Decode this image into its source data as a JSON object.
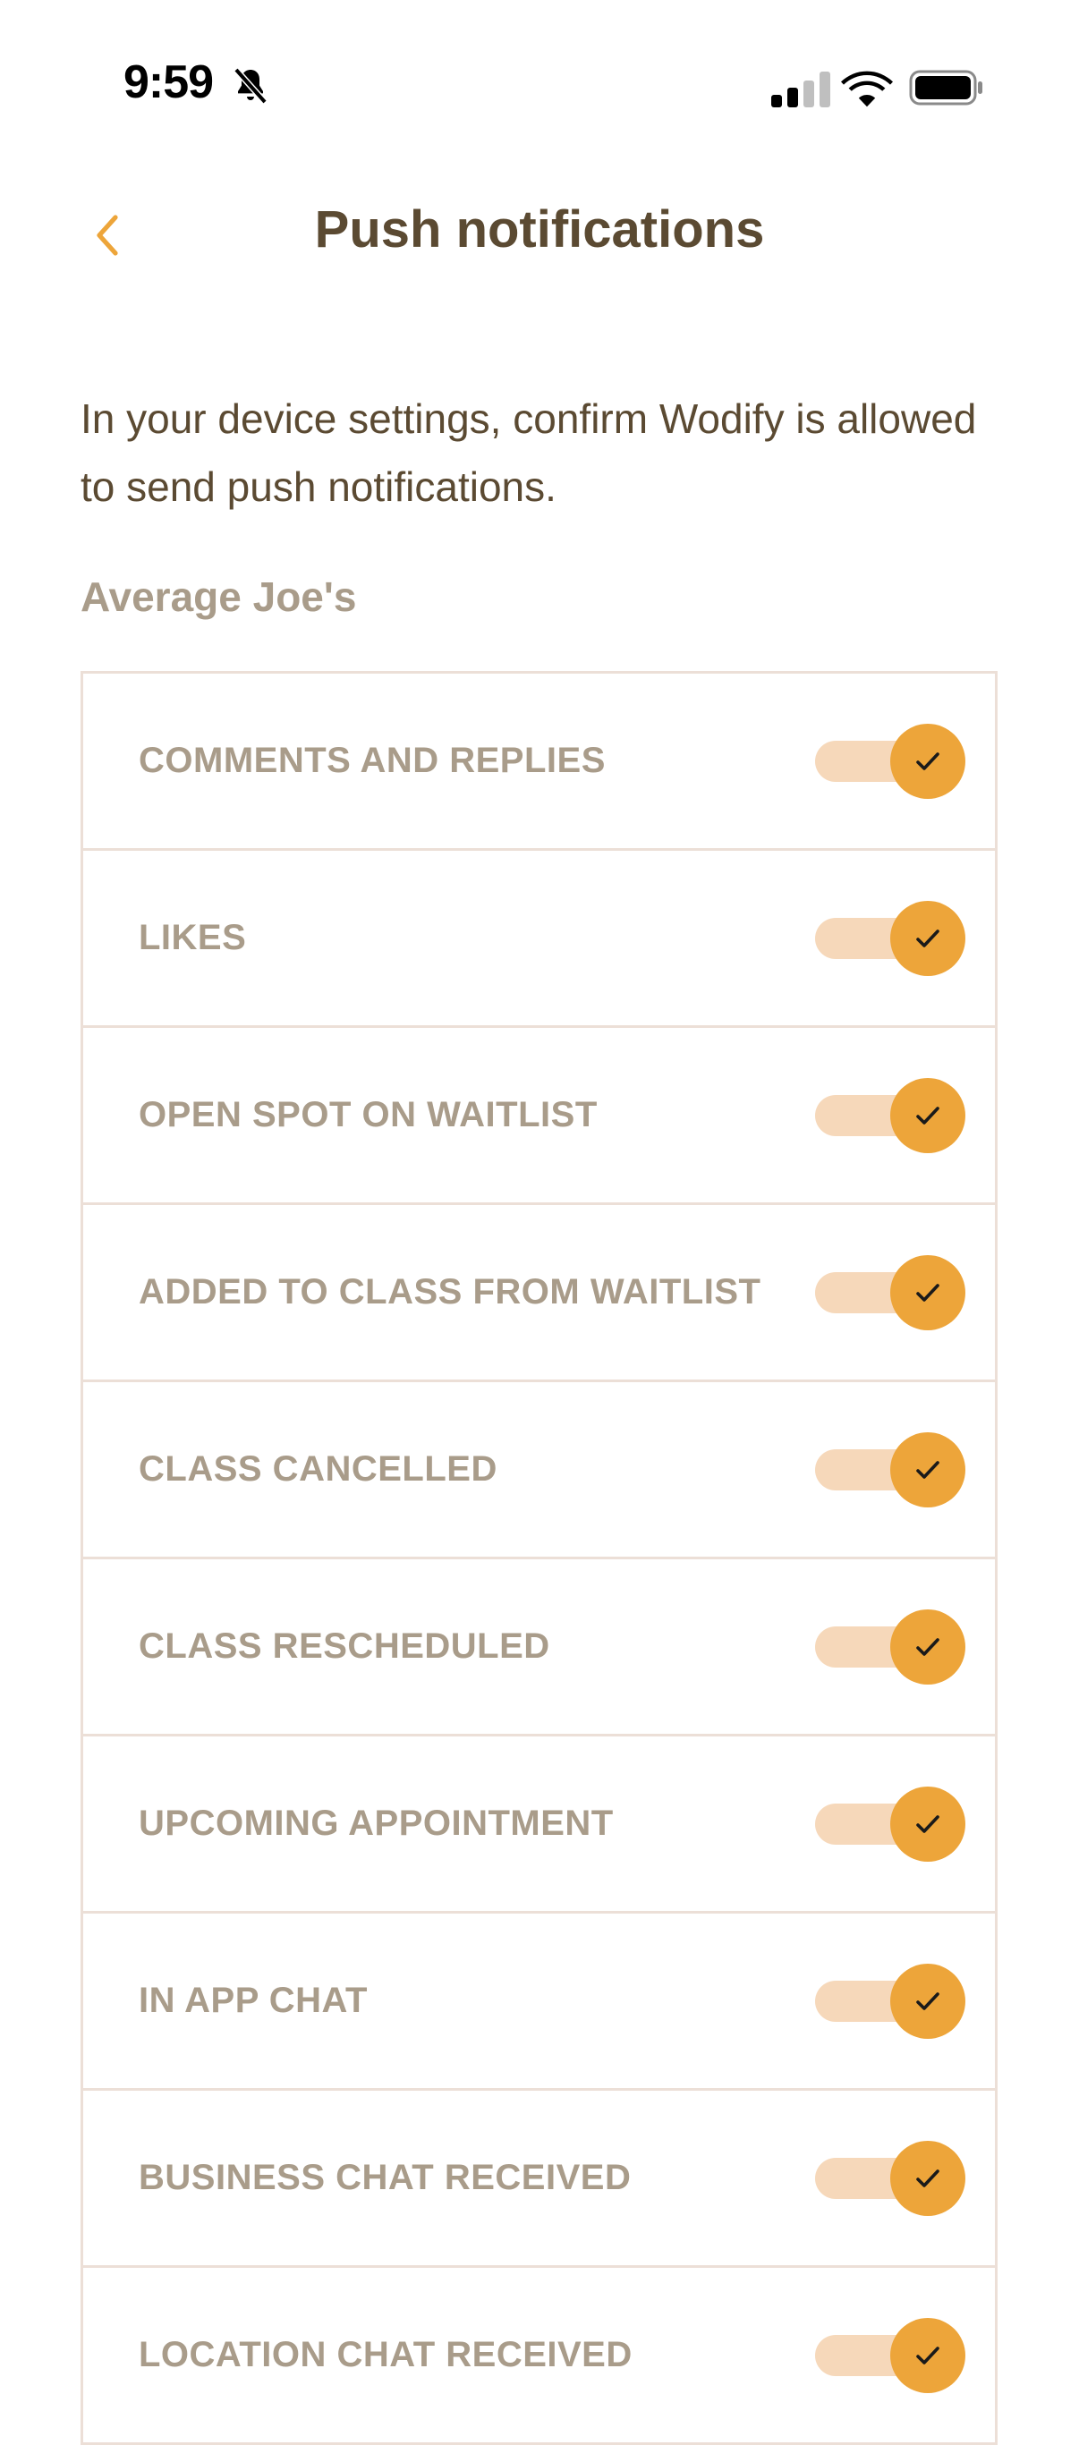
{
  "status_bar": {
    "time": "9:59",
    "icons": [
      "bell-slash-icon",
      "cellular-signal-icon",
      "wifi-icon",
      "battery-icon"
    ]
  },
  "header": {
    "back_icon": "chevron-left-icon",
    "title": "Push notifications"
  },
  "intro_text": "In your device settings, confirm Wodify is allowed to send push notifications.",
  "section": {
    "label": "Average Joe's"
  },
  "settings": [
    {
      "label": "COMMENTS AND REPLIES",
      "enabled": true
    },
    {
      "label": "LIKES",
      "enabled": true
    },
    {
      "label": "OPEN SPOT ON WAITLIST",
      "enabled": true
    },
    {
      "label": "ADDED TO CLASS FROM WAITLIST",
      "enabled": true
    },
    {
      "label": "CLASS CANCELLED",
      "enabled": true
    },
    {
      "label": "CLASS RESCHEDULED",
      "enabled": true
    },
    {
      "label": "UPCOMING APPOINTMENT",
      "enabled": true
    },
    {
      "label": "IN APP CHAT",
      "enabled": true
    },
    {
      "label": "BUSINESS CHAT RECEIVED",
      "enabled": true
    },
    {
      "label": "LOCATION CHAT RECEIVED",
      "enabled": true
    }
  ],
  "colors": {
    "accent": "#eda53a",
    "toggle_track": "#f6d8ba",
    "title_text": "#5b4a32",
    "muted_text": "#a99c8a",
    "divider": "#ecdfd7"
  }
}
